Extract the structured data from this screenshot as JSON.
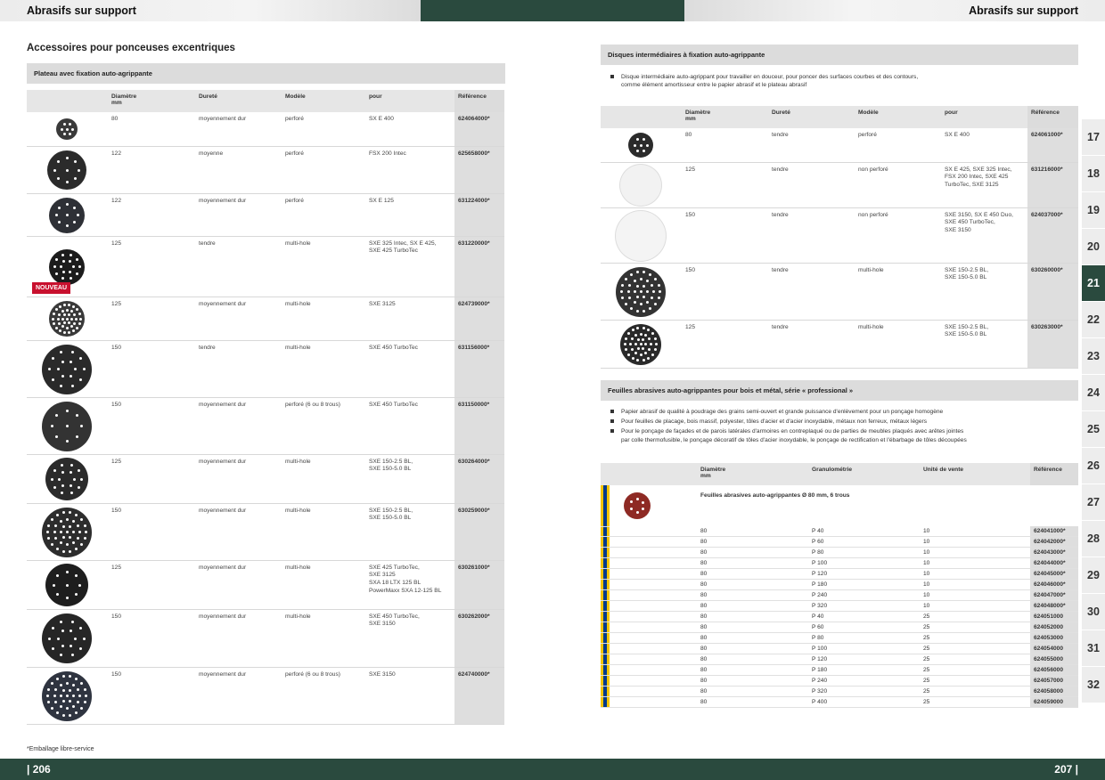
{
  "header": {
    "left_title": "Abrasifs sur support",
    "right_title": "Abrasifs sur support"
  },
  "footer": {
    "left_page": "| 206",
    "right_page": "207 |",
    "note": "*Emballage libre-service"
  },
  "left": {
    "heading": "Accessoires pour ponceuses excentriques",
    "section": "Plateau avec fixation auto-agrippante",
    "columns": [
      "Diamètre\nmm",
      "Dureté",
      "Modèle",
      "pour",
      "Référence"
    ],
    "badge": "NOUVEAU",
    "rows": [
      {
        "d": "80",
        "h": "moyennement dur",
        "m": "perforé",
        "p": "SX E 400",
        "r": "624064000*"
      },
      {
        "d": "122",
        "h": "moyenne",
        "m": "perforé",
        "p": "FSX 200 Intec",
        "r": "625658000*"
      },
      {
        "d": "122",
        "h": "moyennement dur",
        "m": "perforé",
        "p": "SX E 125",
        "r": "631224000*"
      },
      {
        "d": "125",
        "h": "tendre",
        "m": "multi-hole",
        "p": "SXE 325 Intec, SX E 425,\nSXE 425 TurboTec",
        "r": "631220000*"
      },
      {
        "d": "125",
        "h": "moyennement dur",
        "m": "multi-hole",
        "p": "SXE 3125",
        "r": "624739000*"
      },
      {
        "d": "150",
        "h": "tendre",
        "m": "multi-hole",
        "p": "SXE 450 TurboTec",
        "r": "631156000*"
      },
      {
        "d": "150",
        "h": "moyennement dur",
        "m": "perforé (6 ou 8 trous)",
        "p": "SXE 450 TurboTec",
        "r": "631150000*"
      },
      {
        "d": "125",
        "h": "moyennement dur",
        "m": "multi-hole",
        "p": "SXE 150-2.5 BL,\nSXE 150-5.0 BL",
        "r": "630264000*"
      },
      {
        "d": "150",
        "h": "moyennement dur",
        "m": "multi-hole",
        "p": "SXE 150-2.5 BL,\nSXE 150-5.0 BL",
        "r": "630259000*"
      },
      {
        "d": "125",
        "h": "moyennement dur",
        "m": "multi-hole",
        "p": "SXE 425 TurboTec,\nSXE 3125\nSXA 18 LTX 125 BL\nPowerMaxx SXA 12-125 BL",
        "r": "630261000*"
      },
      {
        "d": "150",
        "h": "moyennement dur",
        "m": "multi-hole",
        "p": "SXE 450 TurboTec,\nSXE 3150",
        "r": "630262000*"
      },
      {
        "d": "150",
        "h": "moyennement dur",
        "m": "perforé (6 ou 8 trous)",
        "p": "SXE 3150",
        "r": "624740000*"
      }
    ]
  },
  "right": {
    "section1": "Disques intermédiaires à fixation auto-agrippante",
    "bullets1": [
      "Disque intermédiaire auto-agrippant pour travailler en douceur, pour poncer des surfaces courbes et des contours,\ncomme élément amortisseur entre le papier abrasif et le plateau abrasif"
    ],
    "columns1": [
      "Diamètre\nmm",
      "Dureté",
      "Modèle",
      "pour",
      "Référence"
    ],
    "rows1": [
      {
        "d": "80",
        "h": "tendre",
        "m": "perforé",
        "p": "SX E 400",
        "r": "624061000*"
      },
      {
        "d": "125",
        "h": "tendre",
        "m": "non perforé",
        "p": "SX E 425, SXE 325 Intec,\nFSX 200 Intec, SXE 425\nTurboTec, SXE 3125",
        "r": "631216000*"
      },
      {
        "d": "150",
        "h": "tendre",
        "m": "non perforé",
        "p": "SXE 3150, SX E 450 Duo,\nSXE 450 TurboTec,\nSXE 3150",
        "r": "624037000*"
      },
      {
        "d": "150",
        "h": "tendre",
        "m": "multi-hole",
        "p": "SXE 150-2.5 BL,\nSXE 150-5.0 BL",
        "r": "630260000*"
      },
      {
        "d": "125",
        "h": "tendre",
        "m": "multi-hole",
        "p": "SXE 150-2.5 BL,\nSXE 150-5.0 BL",
        "r": "630263000*"
      }
    ],
    "section2": "Feuilles abrasives auto-agrippantes pour bois et métal, série « professional »",
    "bullets2": [
      "Papier abrasif de qualité à poudrage des grains semi-ouvert et grande puissance d'enlèvement pour un ponçage homogène",
      "Pour feuilles de placage, bois massif, polyester, tôles d'acier et d'acier inoxydable, métaux non ferreux, métaux légers",
      "Pour le ponçage de façades et de parois latérales d'armoires en contreplaqué ou de parties de meubles plaqués avec arêtes jointes\npar colle thermofusible, le ponçage décoratif de tôles d'acier inoxydable, le ponçage de rectification et l'ébarbage de tôles découpées"
    ],
    "columns2": [
      "Diamètre\nmm",
      "Granulométrie",
      "Unité de vente",
      "Référence"
    ],
    "subhead": "Feuilles abrasives auto-agrippantes Ø 80 mm, 6 trous",
    "rows2": [
      {
        "d": "80",
        "g": "P 40",
        "u": "10",
        "r": "624041000*"
      },
      {
        "d": "80",
        "g": "P 60",
        "u": "10",
        "r": "624042000*"
      },
      {
        "d": "80",
        "g": "P 80",
        "u": "10",
        "r": "624043000*"
      },
      {
        "d": "80",
        "g": "P 100",
        "u": "10",
        "r": "624044000*"
      },
      {
        "d": "80",
        "g": "P 120",
        "u": "10",
        "r": "624045000*"
      },
      {
        "d": "80",
        "g": "P 180",
        "u": "10",
        "r": "624046000*"
      },
      {
        "d": "80",
        "g": "P 240",
        "u": "10",
        "r": "624047000*"
      },
      {
        "d": "80",
        "g": "P 320",
        "u": "10",
        "r": "624048000*"
      },
      {
        "d": "80",
        "g": "P 40",
        "u": "25",
        "r": "624051000"
      },
      {
        "d": "80",
        "g": "P 60",
        "u": "25",
        "r": "624052000"
      },
      {
        "d": "80",
        "g": "P 80",
        "u": "25",
        "r": "624053000"
      },
      {
        "d": "80",
        "g": "P 100",
        "u": "25",
        "r": "624054000"
      },
      {
        "d": "80",
        "g": "P 120",
        "u": "25",
        "r": "624055000"
      },
      {
        "d": "80",
        "g": "P 180",
        "u": "25",
        "r": "624056000"
      },
      {
        "d": "80",
        "g": "P 240",
        "u": "25",
        "r": "624057000"
      },
      {
        "d": "80",
        "g": "P 320",
        "u": "25",
        "r": "624058000"
      },
      {
        "d": "80",
        "g": "P 400",
        "u": "25",
        "r": "624059000"
      }
    ]
  },
  "tabs": [
    "17",
    "18",
    "19",
    "20",
    "21",
    "22",
    "23",
    "24",
    "25",
    "26",
    "27",
    "28",
    "29",
    "30",
    "31",
    "32"
  ],
  "active_tab": "21",
  "colors": {
    "brand_green": "#2a4a3e",
    "badge_red": "#c8102e",
    "stripe_yellow": "#f4c400",
    "stripe_blue": "#003a8c"
  }
}
